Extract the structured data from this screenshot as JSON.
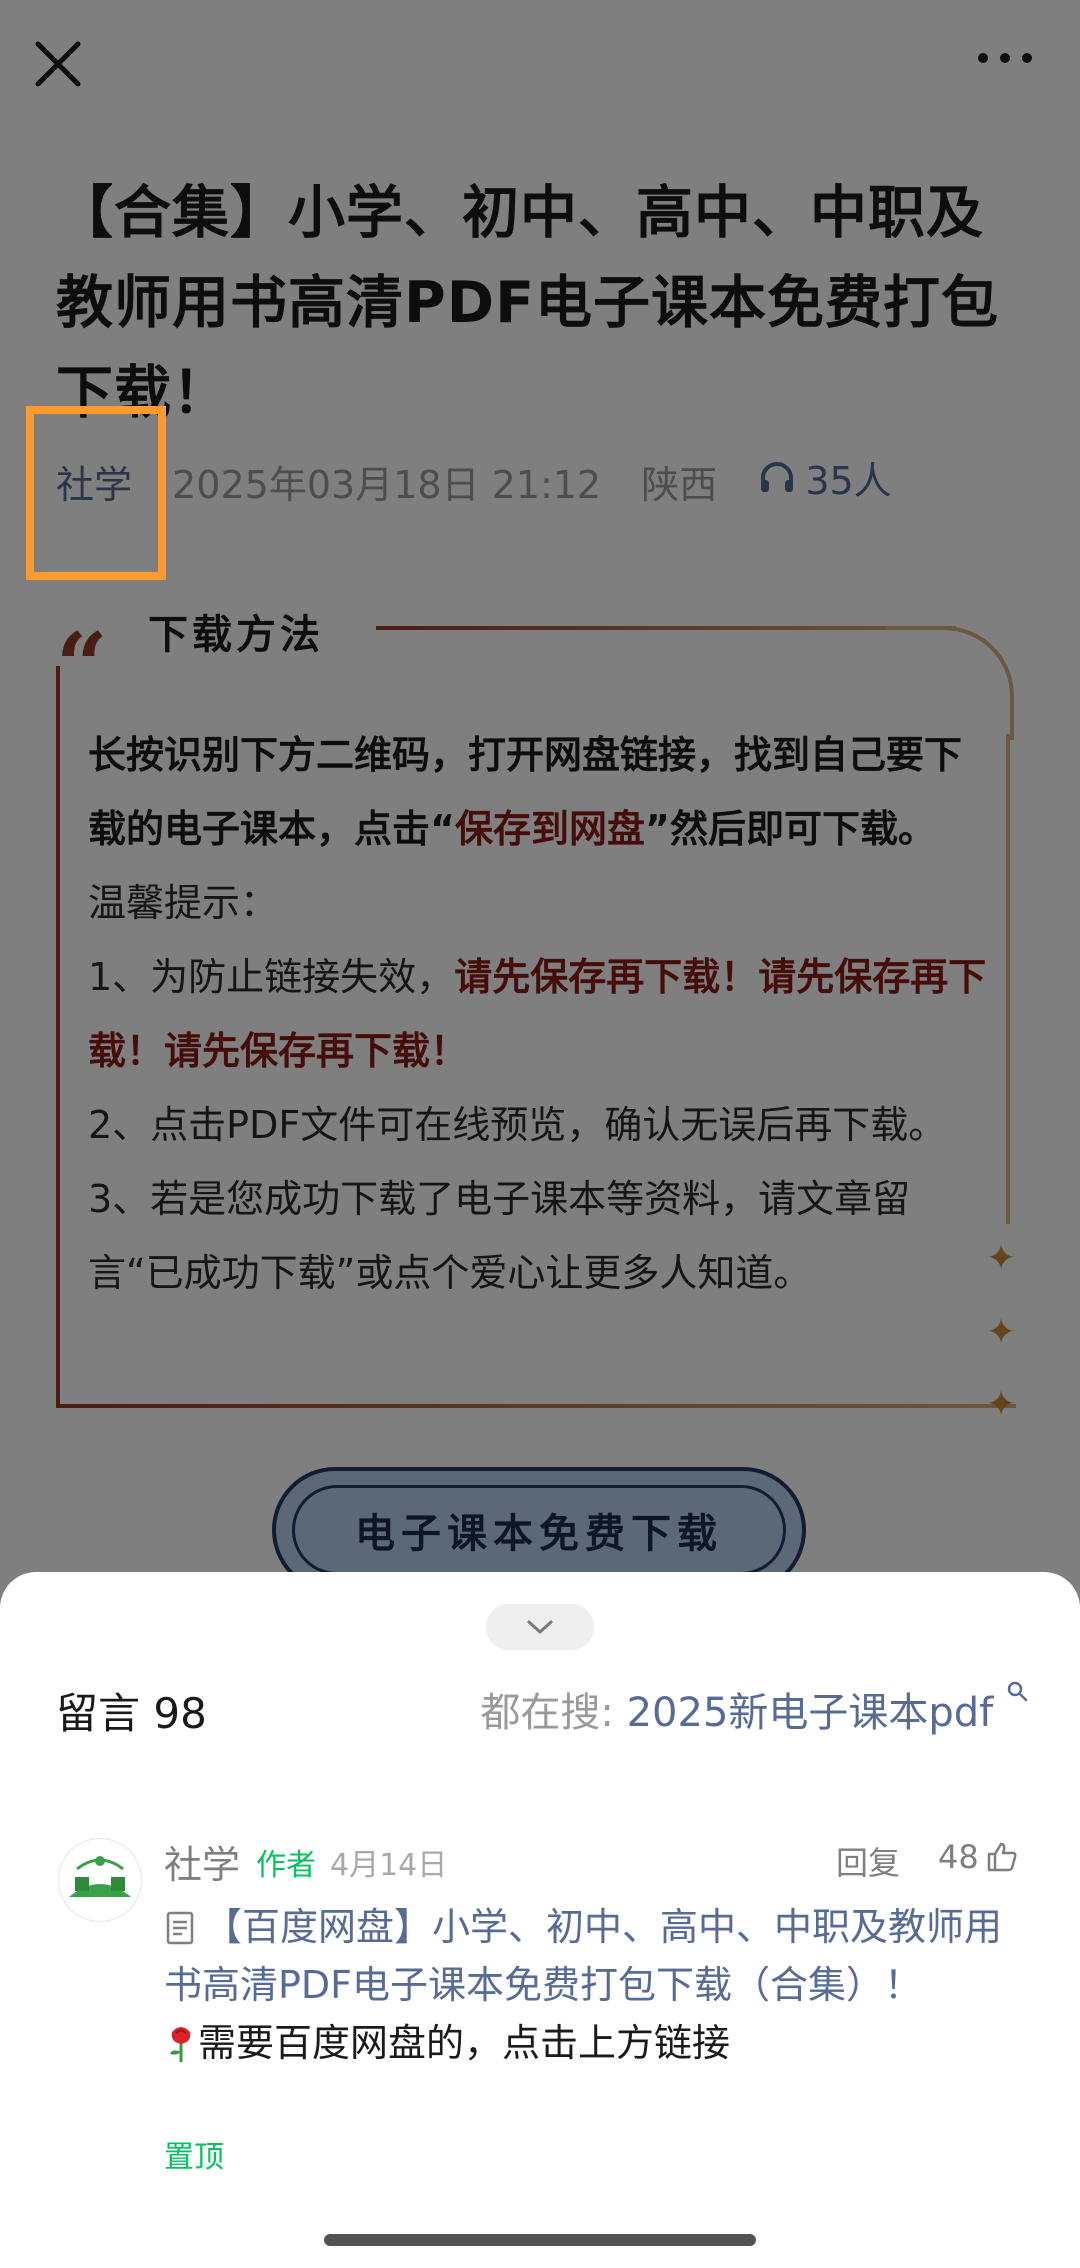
{
  "article": {
    "title": "【合集】小学、初中、高中、中职及教师用书高清PDF电子课本免费打包下载！",
    "author": "社学",
    "datetime": "2025年03月18日 21:12",
    "location": "陕西",
    "listeners": "35人"
  },
  "card": {
    "heading": "下载方法",
    "line1_a": "长按识别下方二维码，打开网盘链接，找到自己要下载的电子课本，点击“",
    "line1_red": "保存到网盘",
    "line1_b": "”然后即可下载。",
    "tip_title": "温馨提示：",
    "tip1_a": "1、为防止链接失效，",
    "tip1_red": "请先保存再下载！请先保存再下载！请先保存再下载！",
    "tip2": "2、点击PDF文件可在线预览，确认无误后再下载。",
    "tip3": "3、若是您成功下载了电子课本等资料，请文章留言“已成功下载”或点个爱心让更多人知道。"
  },
  "download_button": "电子课本免费下载",
  "comments": {
    "title": "留言 98",
    "search_prefix": "都在搜: ",
    "search_query": "2025新电子课本pdf",
    "items": [
      {
        "name": "社学",
        "tag": "作者",
        "date": "4月14日",
        "reply": "回复",
        "likes": "48",
        "link_text": "【百度网盘】小学、初中、高中、中职及教师用书高清PDF电子课本免费打包下载（合集）！",
        "body": "需要百度网盘的，点击上方链接",
        "pinned": "置顶"
      }
    ]
  },
  "colors": {
    "accent_red": "#8b1a12",
    "link_blue": "#576b95",
    "author_green": "#07c160",
    "highlight_orange": "#ff9a2e"
  },
  "icons": [
    "close-icon",
    "more-icon",
    "headphone-icon",
    "chevron-down-icon",
    "search-icon",
    "document-icon",
    "thumbs-up-icon",
    "rose-icon"
  ]
}
